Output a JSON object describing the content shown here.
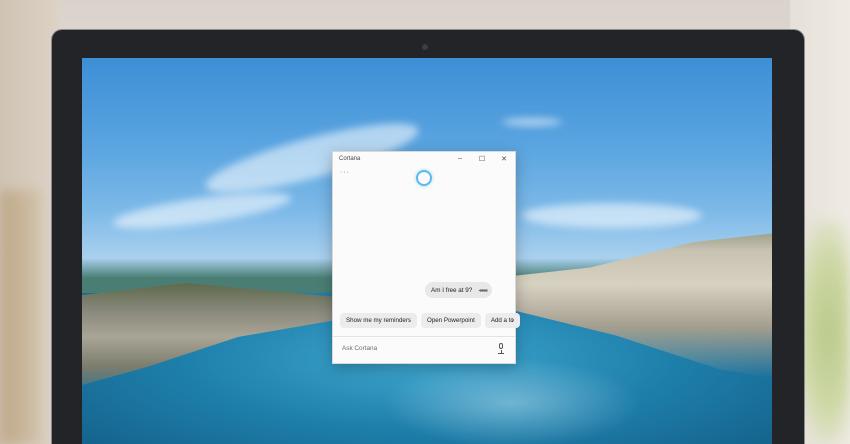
{
  "cortana_window": {
    "title": "Cortana",
    "controls": {
      "minimize": "–",
      "maximize": "☐",
      "close": "✕"
    },
    "menu_dots": "···",
    "ring_color": "#5bb8f0",
    "user_query": "Am I free at 9?",
    "query_audio_indicator": "◂◂◂◂",
    "suggestions": [
      "Show me my reminders",
      "Open Powerpoint",
      "Add a to"
    ],
    "suggestions_more": "›",
    "input_placeholder": "Ask Cortana"
  },
  "icons": {
    "microphone": "microphone-icon",
    "scroll_right": "chevron-right-icon"
  }
}
